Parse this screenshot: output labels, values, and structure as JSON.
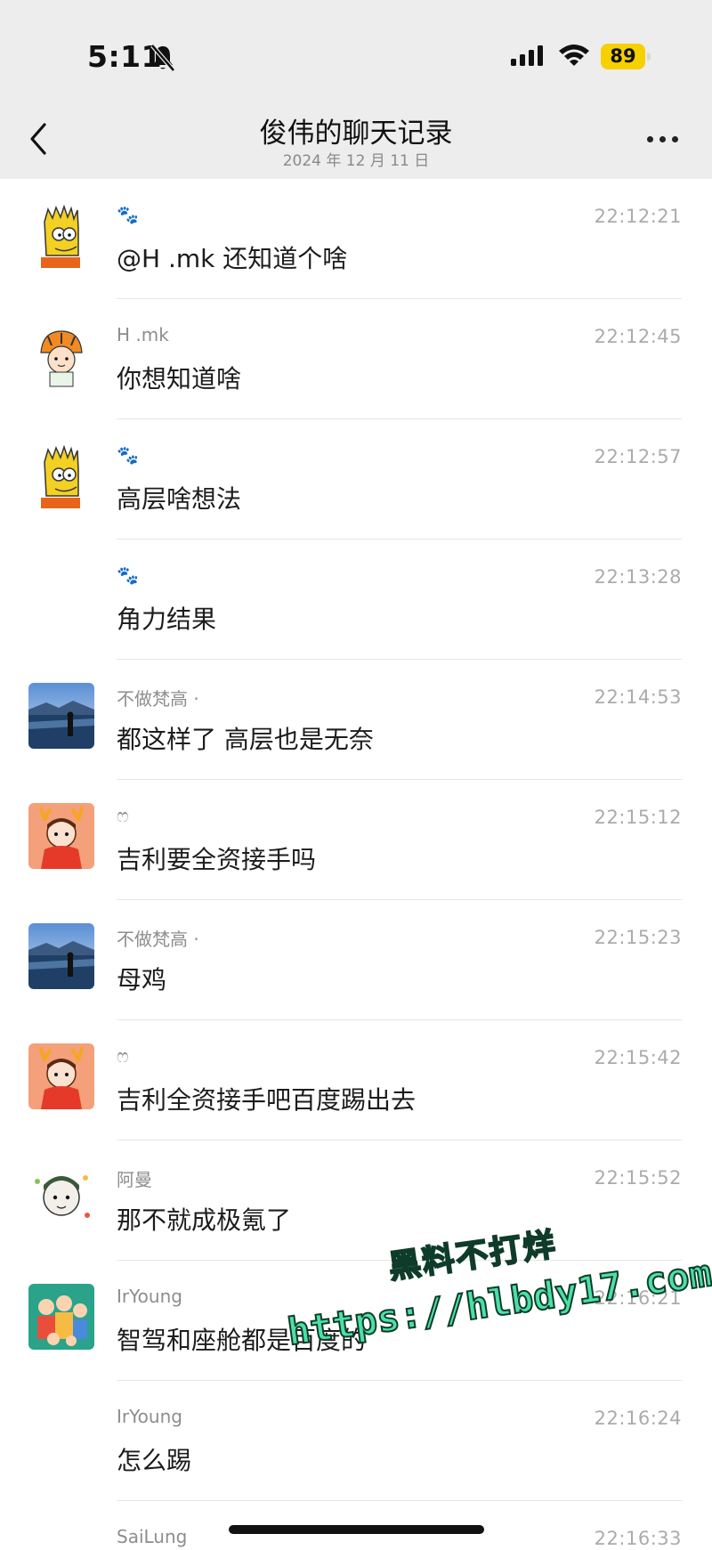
{
  "status_bar": {
    "time": "5:11",
    "battery": "89"
  },
  "nav": {
    "title": "俊伟的聊天记录",
    "subtitle": "2024 年 12 月 11 日"
  },
  "messages": [
    {
      "sender": "🐾",
      "time": "22:12:21",
      "text": "@H .mk 还知道个啥",
      "avatar": "bart-avatar"
    },
    {
      "sender": "H .mk",
      "time": "22:12:45",
      "text": "你想知道啥",
      "avatar": "tiger-hat-avatar"
    },
    {
      "sender": "🐾",
      "time": "22:12:57",
      "text": "高层啥想法",
      "avatar": "bart-avatar"
    },
    {
      "sender": "🐾",
      "time": "22:13:28",
      "text": "角力结果",
      "avatar": "none"
    },
    {
      "sender": "不做梵高 ·",
      "time": "22:14:53",
      "text": "都这样了 高层也是无奈",
      "avatar": "lake-photo-avatar"
    },
    {
      "sender": "ෆ",
      "time": "22:15:12",
      "text": "吉利要全资接手吗",
      "avatar": "antler-girl-avatar"
    },
    {
      "sender": "不做梵高 ·",
      "time": "22:15:23",
      "text": "母鸡",
      "avatar": "lake-photo-avatar"
    },
    {
      "sender": "ෆ",
      "time": "22:15:42",
      "text": "吉利全资接手吧百度踢出去",
      "avatar": "antler-girl-avatar"
    },
    {
      "sender": "阿曼",
      "time": "22:15:52",
      "text": "那不就成极氪了",
      "avatar": "sticker-avatar"
    },
    {
      "sender": "IrYoung",
      "time": "22:16:21",
      "text": "智驾和座舱都是百度的",
      "avatar": "family-cartoon-avatar"
    },
    {
      "sender": "IrYoung",
      "time": "22:16:24",
      "text": "怎么踢",
      "avatar": "none"
    },
    {
      "sender": "SaiLung",
      "time": "22:16:33",
      "text": "",
      "avatar": "dark-avatar"
    }
  ],
  "watermark": {
    "line1": "黑料不打烊",
    "line2": "https://hlbdy17.com"
  },
  "colors": {
    "topbar_bg": "#ededed",
    "battery": "#f7d000",
    "watermark": "#4ce0a6"
  }
}
